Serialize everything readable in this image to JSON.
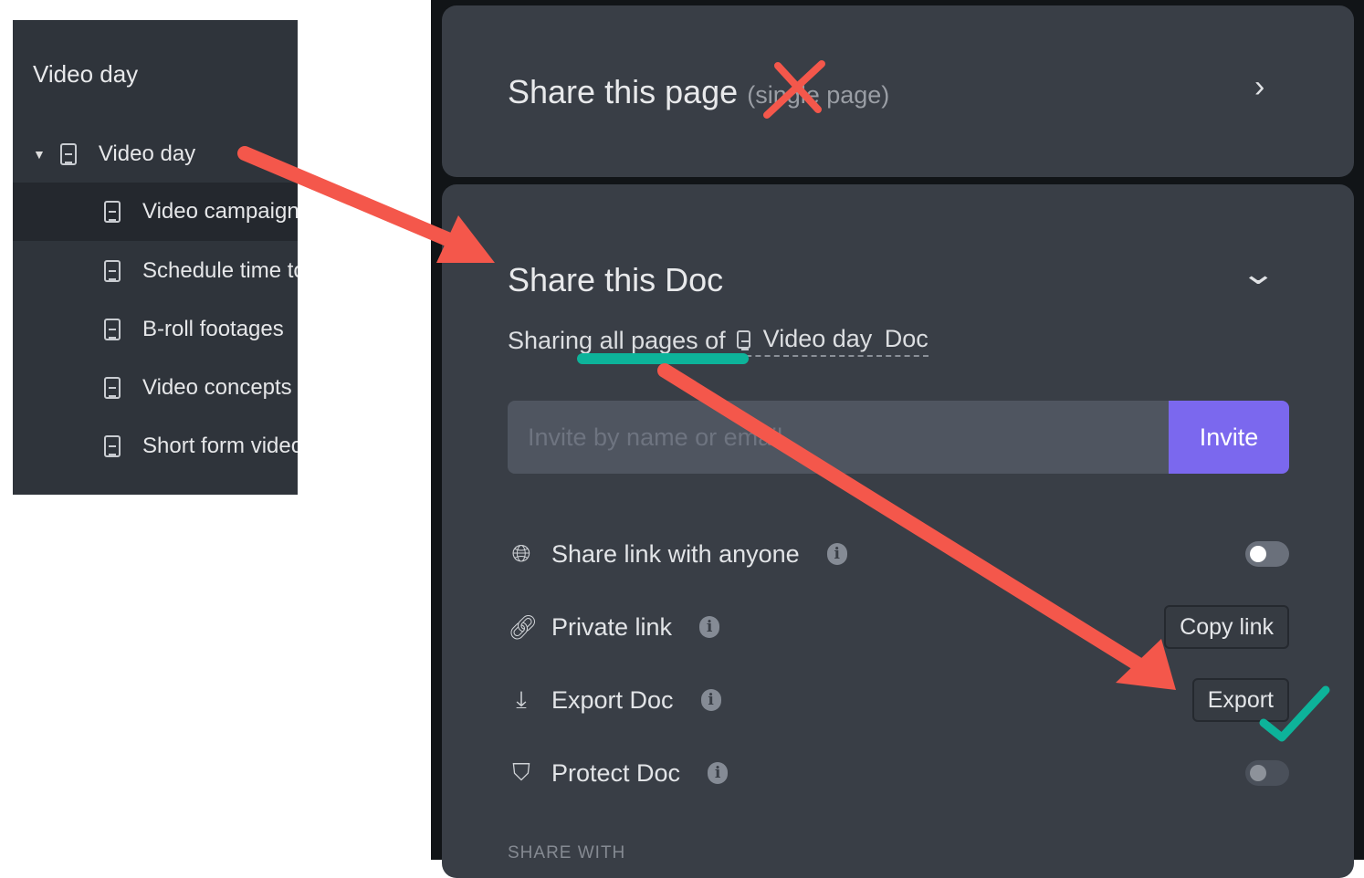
{
  "sidebar": {
    "title": "Video day",
    "items": [
      {
        "label": "Video day",
        "expanded": true
      },
      {
        "label": "Video campaign",
        "selected": true
      },
      {
        "label": "Schedule time to film"
      },
      {
        "label": "B-roll footages"
      },
      {
        "label": "Video concepts"
      },
      {
        "label": "Short form videos"
      }
    ]
  },
  "share_page": {
    "title": "Share this page",
    "subtitle": "(single page)"
  },
  "share_doc": {
    "title": "Share this Doc",
    "sharing_prefix": "Sharing all pages of",
    "doc_name": "Video day",
    "doc_suffix": "Doc",
    "invite_placeholder": "Invite by name or email",
    "invite_label": "Invite",
    "rows": [
      {
        "label": "Share link with anyone",
        "icon": "globe-icon",
        "toggle_on": false
      },
      {
        "label": "Private link",
        "icon": "link-icon",
        "button": "Copy link"
      },
      {
        "label": "Export Doc",
        "icon": "download-icon",
        "button": "Export"
      },
      {
        "label": "Protect Doc",
        "icon": "shield-icon",
        "toggle_on": false
      }
    ],
    "share_with_label": "SHARE WITH"
  },
  "colors": {
    "accent": "#7b68ee",
    "annotation_red": "#f4574b",
    "annotation_teal": "#0db39a"
  }
}
